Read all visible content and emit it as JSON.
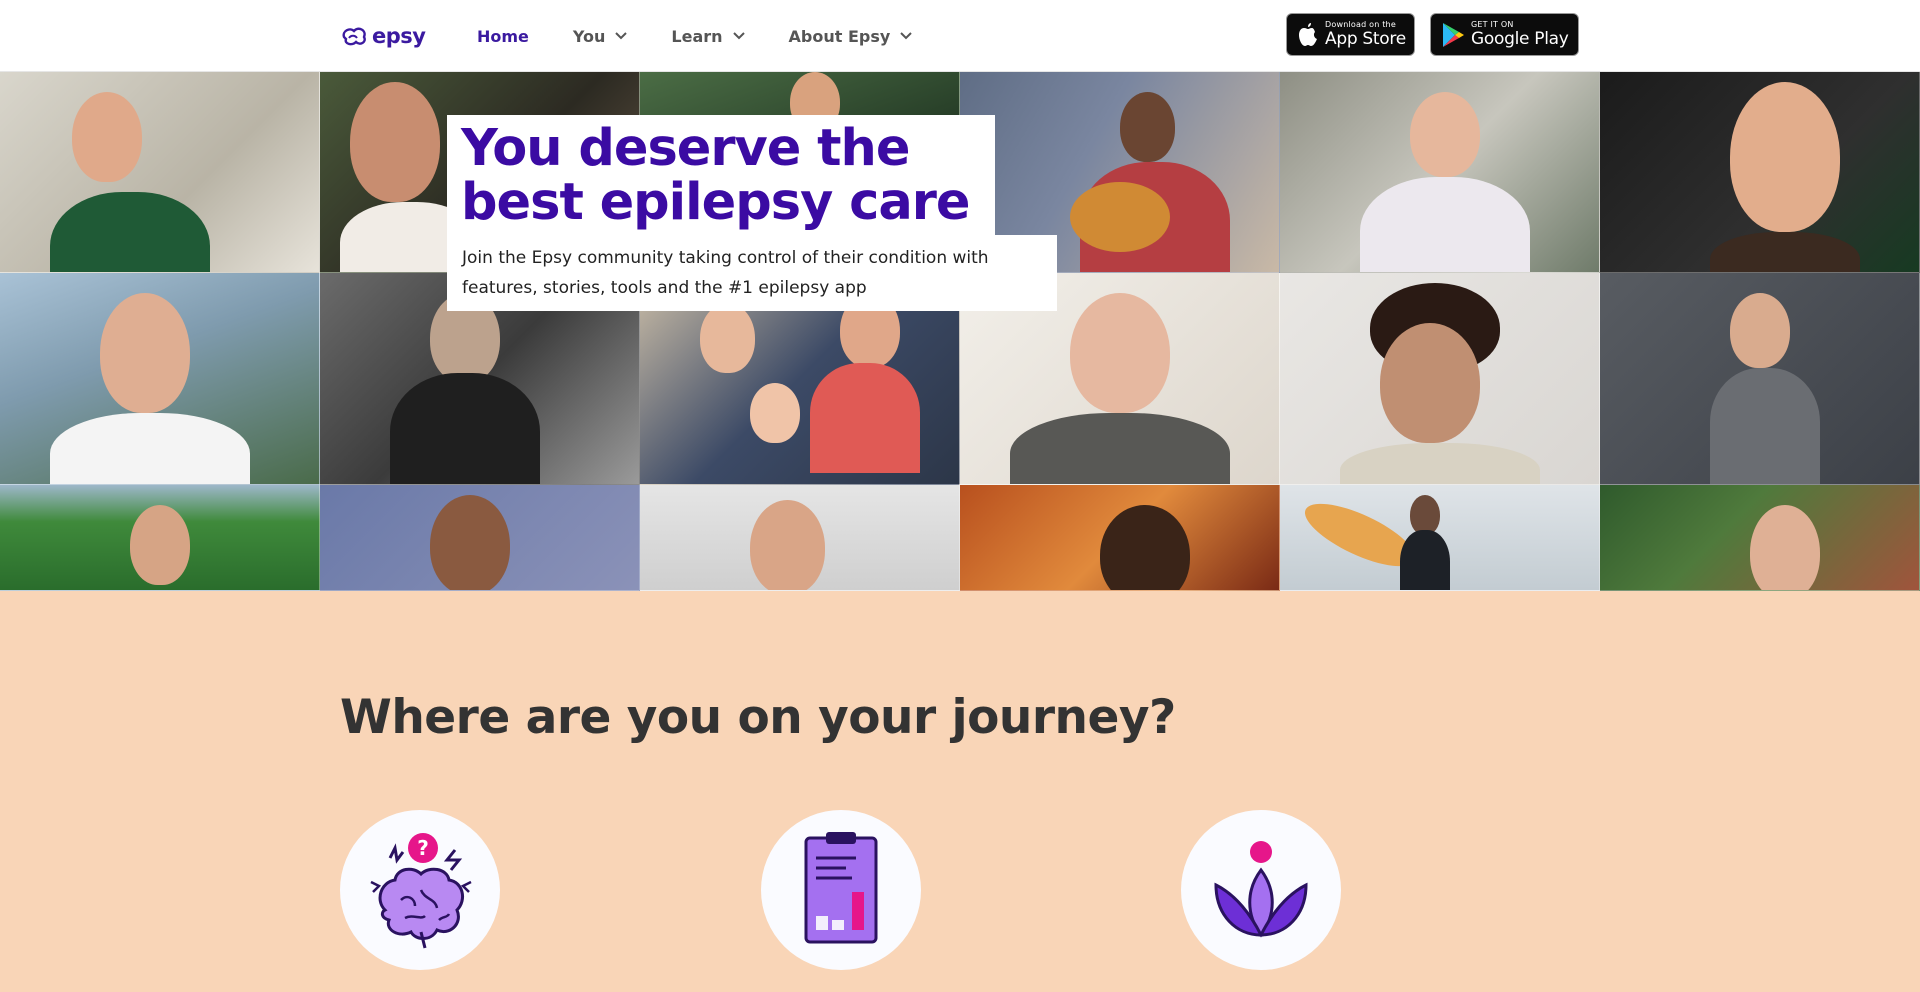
{
  "header": {
    "logo_text": "epsy",
    "nav": [
      {
        "label": "Home",
        "active": true,
        "has_dropdown": false
      },
      {
        "label": "You",
        "active": false,
        "has_dropdown": true
      },
      {
        "label": "Learn",
        "active": false,
        "has_dropdown": true
      },
      {
        "label": "About Epsy",
        "active": false,
        "has_dropdown": true
      }
    ],
    "app_store": {
      "small": "Download on the",
      "big": "App Store",
      "icon": "apple-icon"
    },
    "google_play": {
      "small": "GET IT ON",
      "big": "Google Play",
      "icon": "google-play-icon"
    }
  },
  "hero": {
    "title": "You deserve the best epilepsy care",
    "subtitle": "Join the Epsy community taking control of their condition with features, stories, tools and the #1 epilepsy app"
  },
  "journey": {
    "title": "Where are you on your journey?",
    "cards": [
      {
        "icon": "brain-question-icon"
      },
      {
        "icon": "clipboard-chart-icon"
      },
      {
        "icon": "lotus-icon"
      }
    ]
  },
  "colors": {
    "brand_purple": "#3b0ba3",
    "section_bg": "#f9d5b7",
    "accent_pink": "#e6168a"
  }
}
